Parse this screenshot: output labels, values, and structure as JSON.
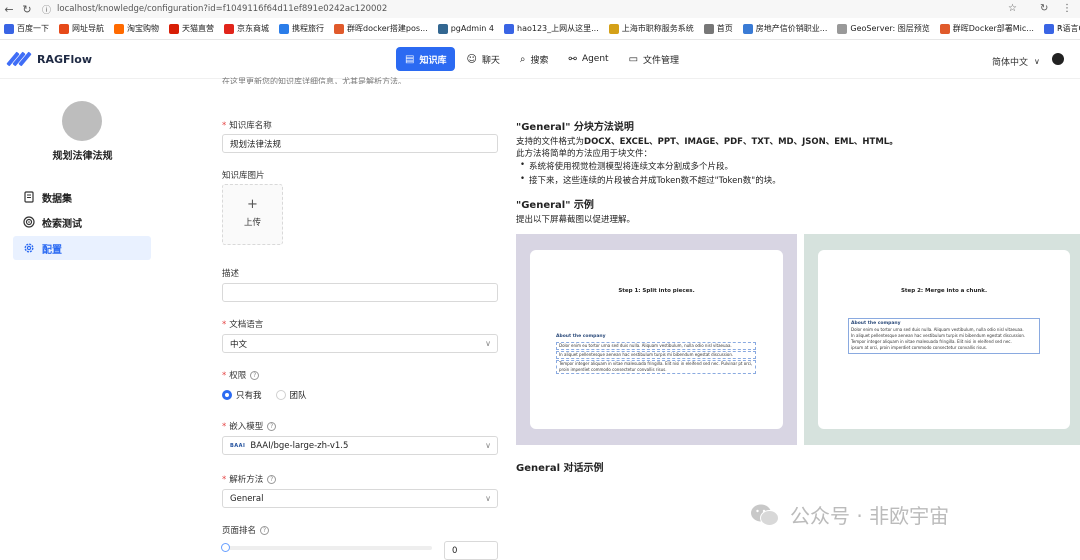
{
  "browser": {
    "url": "localhost/knowledge/configuration?id=f1049116f64d11ef891e0242ac120002",
    "bookmarks": [
      {
        "label": "百度一下",
        "color": "#3964e4"
      },
      {
        "label": "网址导航",
        "color": "#e64a19"
      },
      {
        "label": "淘宝购物",
        "color": "#ff6a00"
      },
      {
        "label": "天猫直营",
        "color": "#d81e06"
      },
      {
        "label": "京东商城",
        "color": "#e1251b"
      },
      {
        "label": "携程旅行",
        "color": "#2b7de9"
      },
      {
        "label": "群晖docker搭建pos...",
        "color": "#e05a2b"
      },
      {
        "label": "pgAdmin 4",
        "color": "#336791"
      },
      {
        "label": "hao123_上网从这里...",
        "color": "#3964e4"
      },
      {
        "label": "上海市职称服务系统",
        "color": "#d4a017"
      },
      {
        "label": "首页",
        "color": "#777777"
      },
      {
        "label": "房地产信价销职业...",
        "color": "#3a7bd5"
      },
      {
        "label": "GeoServer: 图层预览",
        "color": "#999999"
      },
      {
        "label": "群晖Docker部署Mic...",
        "color": "#e05a2b"
      },
      {
        "label": "R语言GD包：地理...",
        "color": "#3964e4"
      }
    ]
  },
  "app": {
    "logo": "RAGFlow",
    "nav": [
      {
        "label": "知识库",
        "icon": "database-icon",
        "active": true
      },
      {
        "label": "聊天",
        "icon": "chat-icon",
        "active": false
      },
      {
        "label": "搜索",
        "icon": "search-icon",
        "active": false
      },
      {
        "label": "Agent",
        "icon": "agent-icon",
        "active": false
      },
      {
        "label": "文件管理",
        "icon": "folder-icon",
        "active": false
      }
    ],
    "language": "简体中文"
  },
  "sidebar": {
    "kb_name": "规划法律法规",
    "items": [
      {
        "label": "数据集",
        "icon": "dataset-icon",
        "active": false
      },
      {
        "label": "检索测试",
        "icon": "target-icon",
        "active": false
      },
      {
        "label": "配置",
        "icon": "gear-icon",
        "active": true
      }
    ]
  },
  "form": {
    "top_hint": "在这里更新您的知识库详细信息，尤其是解析方法。",
    "name_label": "知识库名称",
    "name_value": "规划法律法规",
    "image_label": "知识库图片",
    "upload_label": "上传",
    "desc_label": "描述",
    "desc_value": "",
    "lang_label": "文档语言",
    "lang_value": "中文",
    "perm_label": "权限",
    "perm_options": [
      "只有我",
      "团队"
    ],
    "perm_selected": "只有我",
    "embed_label": "嵌入模型",
    "embed_value": "BAAI/bge-large-zh-v1.5",
    "embed_badge": "BAAI",
    "parse_label": "解析方法",
    "parse_value": "General",
    "rank_label": "页面排名",
    "rank_value": "0"
  },
  "right": {
    "title1": "\"General\" 分块方法说明",
    "formats_prefix": "支持的文件格式为",
    "formats": "DOCX、EXCEL、PPT、IMAGE、PDF、TXT、MD、JSON、EML、HTML。",
    "line2": "此方法将简单的方法应用于块文件：",
    "bullet1": "系统将使用视觉检测模型将连续文本分割成多个片段。",
    "bullet2": "接下来，这些连续的片段被合并成Token数不超过\"Token数\"的块。",
    "title2": "\"General\" 示例",
    "line3": "提出以下屏幕截图以促进理解。",
    "step1": "Step 1: Split into pieces.",
    "step2": "Step 2: Merge into a chunk.",
    "mini_heading": "About the company",
    "mini_l1": "Dolor enim eu tortor urna sed duis nulla. Aliquam vestibulum, nulla odio nisl vitaeuaa.",
    "mini_l2": "In aliquet pellentesque aenean hac vestibulum turpis mi bibendum egestat discussion.",
    "mini_l3": "Tempor integer aliquam in vitae malesuada fringilla. Elit nisi in eleifend sed nec. Pulvinar pt orci, proin imperdiet commodo consectetur convallis risus.",
    "mini_m1": "Dolor enim eu tortor urna sed duis nulla. Aliquam vestibulum, nulla odio nisl vitaeuaa.",
    "mini_m2": "In aliquet pellentesque aenean hac vestibulum turpis mi bibendum egestat discussion.",
    "mini_m3": "Tempor integer aliquam in vitae malesuada fringilla. Elit nisi in eleifend sed nec.",
    "mini_m4": "ipsum at orci, proin imperdiet commodo consectetur convallis risus.",
    "title3": "General 对话示例"
  },
  "watermark": "公众号 · 非欧宇宙"
}
